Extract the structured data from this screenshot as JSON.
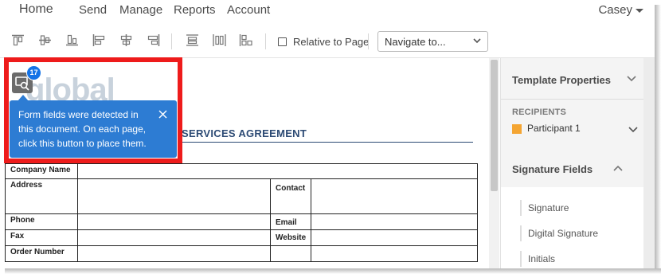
{
  "nav": {
    "items": [
      "Home",
      "Send",
      "Manage",
      "Reports",
      "Account"
    ],
    "user": "Casey"
  },
  "toolbar": {
    "relative_to_page": "Relative to Page",
    "relative_checked": false,
    "navigate_placeholder": "Navigate to..."
  },
  "document": {
    "logo_text": "global",
    "agreement_title": "SERVICES AGREEMENT",
    "table": {
      "first_row_label": "Company Name",
      "rows": [
        {
          "left": "Address",
          "right": "Contact"
        },
        {
          "left": "Phone",
          "right": "Email"
        },
        {
          "left": "Fax",
          "right": "Website"
        },
        {
          "left": "Order Number",
          "right": ""
        }
      ]
    }
  },
  "callout": {
    "badge_count": "17",
    "message": "Form fields were detected in this document. On each page, click this button to place them.",
    "highlight_color": "#ee1b1b",
    "tooltip_color": "#2d7cd3"
  },
  "panel": {
    "template_properties": "Template Properties",
    "recipients_label": "RECIPIENTS",
    "participant": "Participant 1",
    "participant_color": "#f4a532",
    "signature_fields": "Signature Fields",
    "fields": [
      "Signature",
      "Digital Signature",
      "Initials"
    ]
  }
}
